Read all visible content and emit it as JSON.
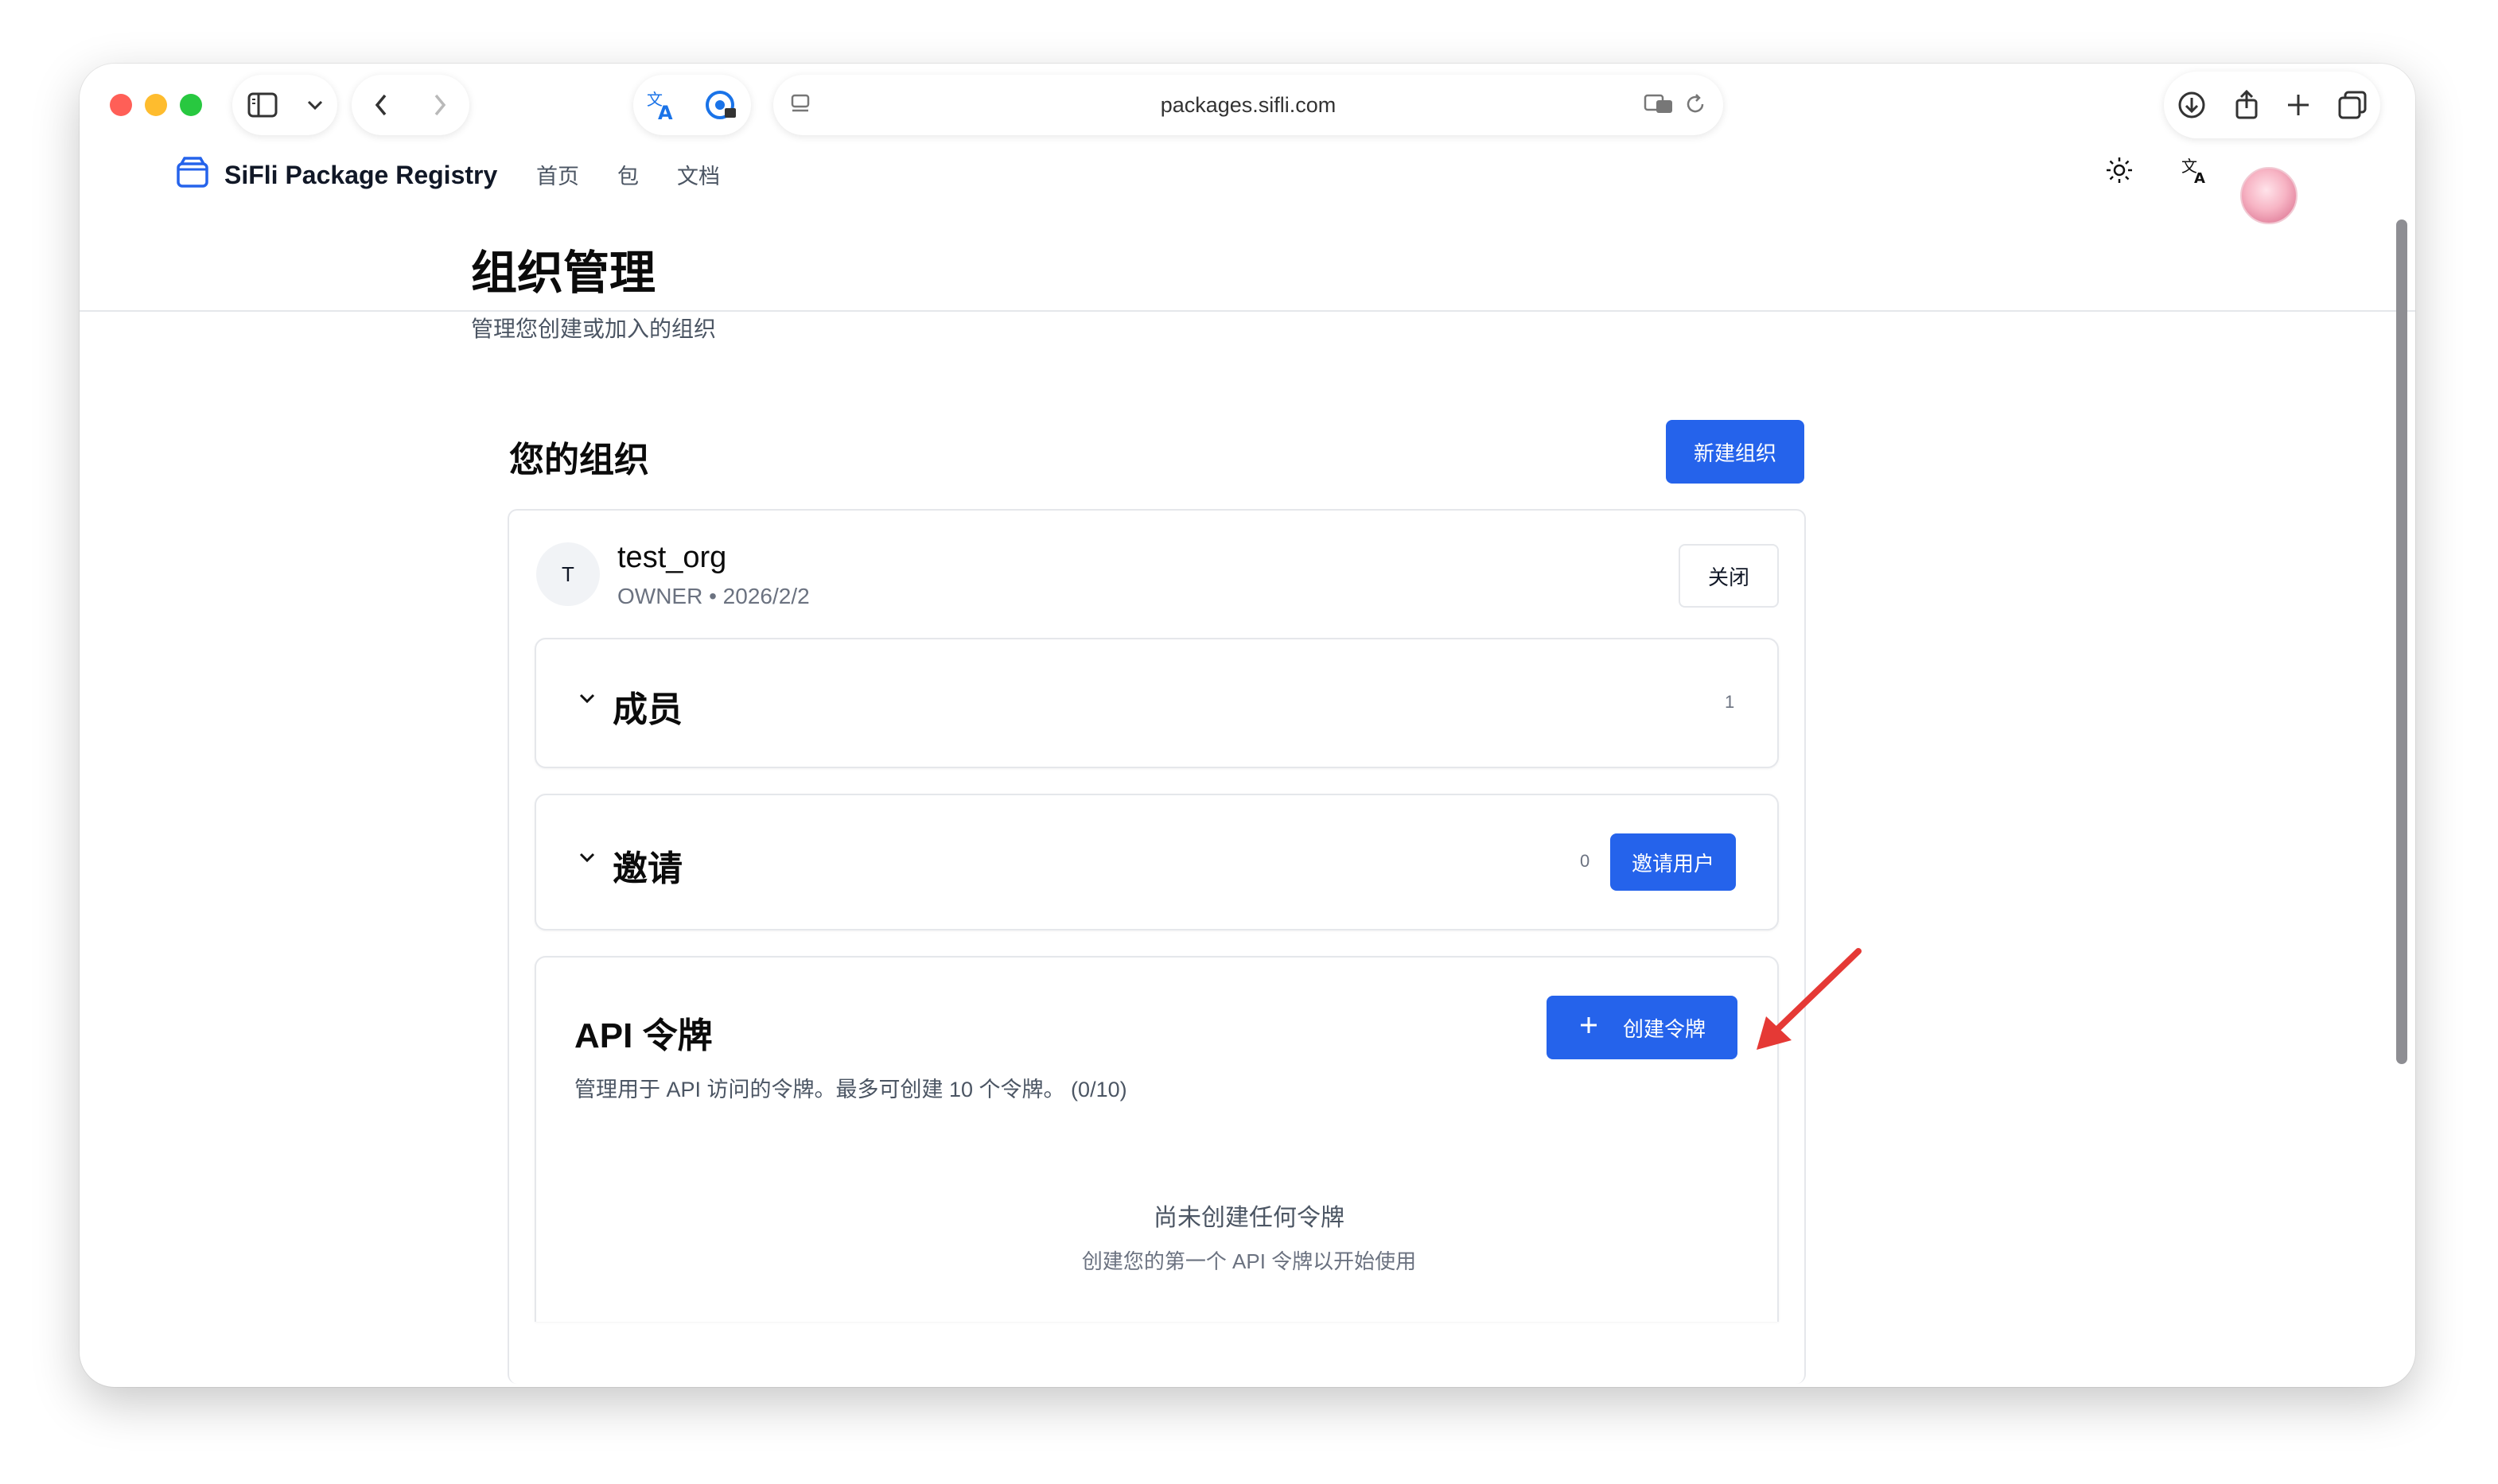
{
  "browser": {
    "url": "packages.sifli.com"
  },
  "header": {
    "brand": "SiFli Package Registry",
    "nav": [
      "首页",
      "包",
      "文档"
    ],
    "icons": [
      "theme-toggle-sun-icon",
      "translate-icon",
      "user-avatar"
    ]
  },
  "page": {
    "title": "组织管理",
    "subtitle": "管理您创建或加入的组织"
  },
  "orgs_section": {
    "title": "您的组织",
    "new_button": "新建组织"
  },
  "org": {
    "initial": "T",
    "name": "test_org",
    "meta": "OWNER • 2026/2/2",
    "close_button": "关闭"
  },
  "members": {
    "title": "成员",
    "count": "1"
  },
  "invites": {
    "title": "邀请",
    "count": "0",
    "button": "邀请用户"
  },
  "api_tokens": {
    "title": "API 令牌",
    "description": "管理用于 API 访问的令牌。最多可创建 10 个令牌。 (0/10)",
    "create_button": "创建令牌",
    "empty_title": "尚未创建任何令牌",
    "empty_subtitle": "创建您的第一个 API 令牌以开始使用"
  },
  "colors": {
    "primary": "#2563eb",
    "annotation_arrow": "#e53935"
  }
}
